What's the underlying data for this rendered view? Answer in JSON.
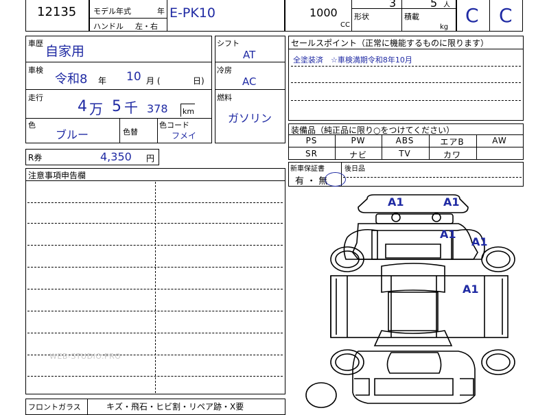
{
  "header": {
    "lot_number": "12135",
    "model_year_label": "モデル年式",
    "year_unit": "年",
    "model_code": "E-PK10",
    "handle_label": "ハンドル",
    "handle_options": "左・右",
    "displacement": "1000",
    "displacement_unit": "CC",
    "doors": "3",
    "seats": "5",
    "seats_unit": "人",
    "shape_label": "形状",
    "load_label": "積載",
    "load_unit": "kg",
    "grade_left": "C",
    "grade_right": "C"
  },
  "history": {
    "label": "車歴",
    "value": "自家用"
  },
  "inspection": {
    "label": "車検",
    "era_year": "令和8",
    "year_unit": "年",
    "month": "10",
    "month_unit": "月 (",
    "day_unit": "日)"
  },
  "mileage": {
    "label": "走行",
    "man": "4",
    "man_unit": "万",
    "sen": "5",
    "sen_unit": "千",
    "rest": "378",
    "unit": "km"
  },
  "color": {
    "label": "色",
    "value": "ブルー",
    "change_label": "色替",
    "code_label": "色コード",
    "code_value": "フメイ"
  },
  "shift": {
    "label": "シフト",
    "value": "AT"
  },
  "cooling": {
    "label": "冷房",
    "value": "AC"
  },
  "fuel": {
    "label": "燃料",
    "value": "ガソリン"
  },
  "sales_points": {
    "title": "セールスポイント（正常に機能するものに限ります）",
    "line1": "全塗装済　☆車検満期令和8年10月"
  },
  "equipment": {
    "title": "装備品（純正品に限り○をつけてください）",
    "row1": [
      "PS",
      "PW",
      "ABS",
      "エアB",
      "AW"
    ],
    "row2": [
      "SR",
      "ナビ",
      "TV",
      "カワ",
      ""
    ]
  },
  "recycle": {
    "label": "R券",
    "value": "4,350",
    "unit": "円"
  },
  "warranty": {
    "label": "新車保証書",
    "options": "有 ・ 無",
    "after_label": "後日品"
  },
  "notes": {
    "title": "注意事項申告欄"
  },
  "windshield": {
    "label": "フロントガラス",
    "options": "キズ・飛石・ヒビ割・リペア跡・X要"
  },
  "diagram_marks": [
    "A1",
    "A1",
    "A1",
    "A1",
    "A1"
  ],
  "watermark": "WEB-STUDIO.PRO"
}
